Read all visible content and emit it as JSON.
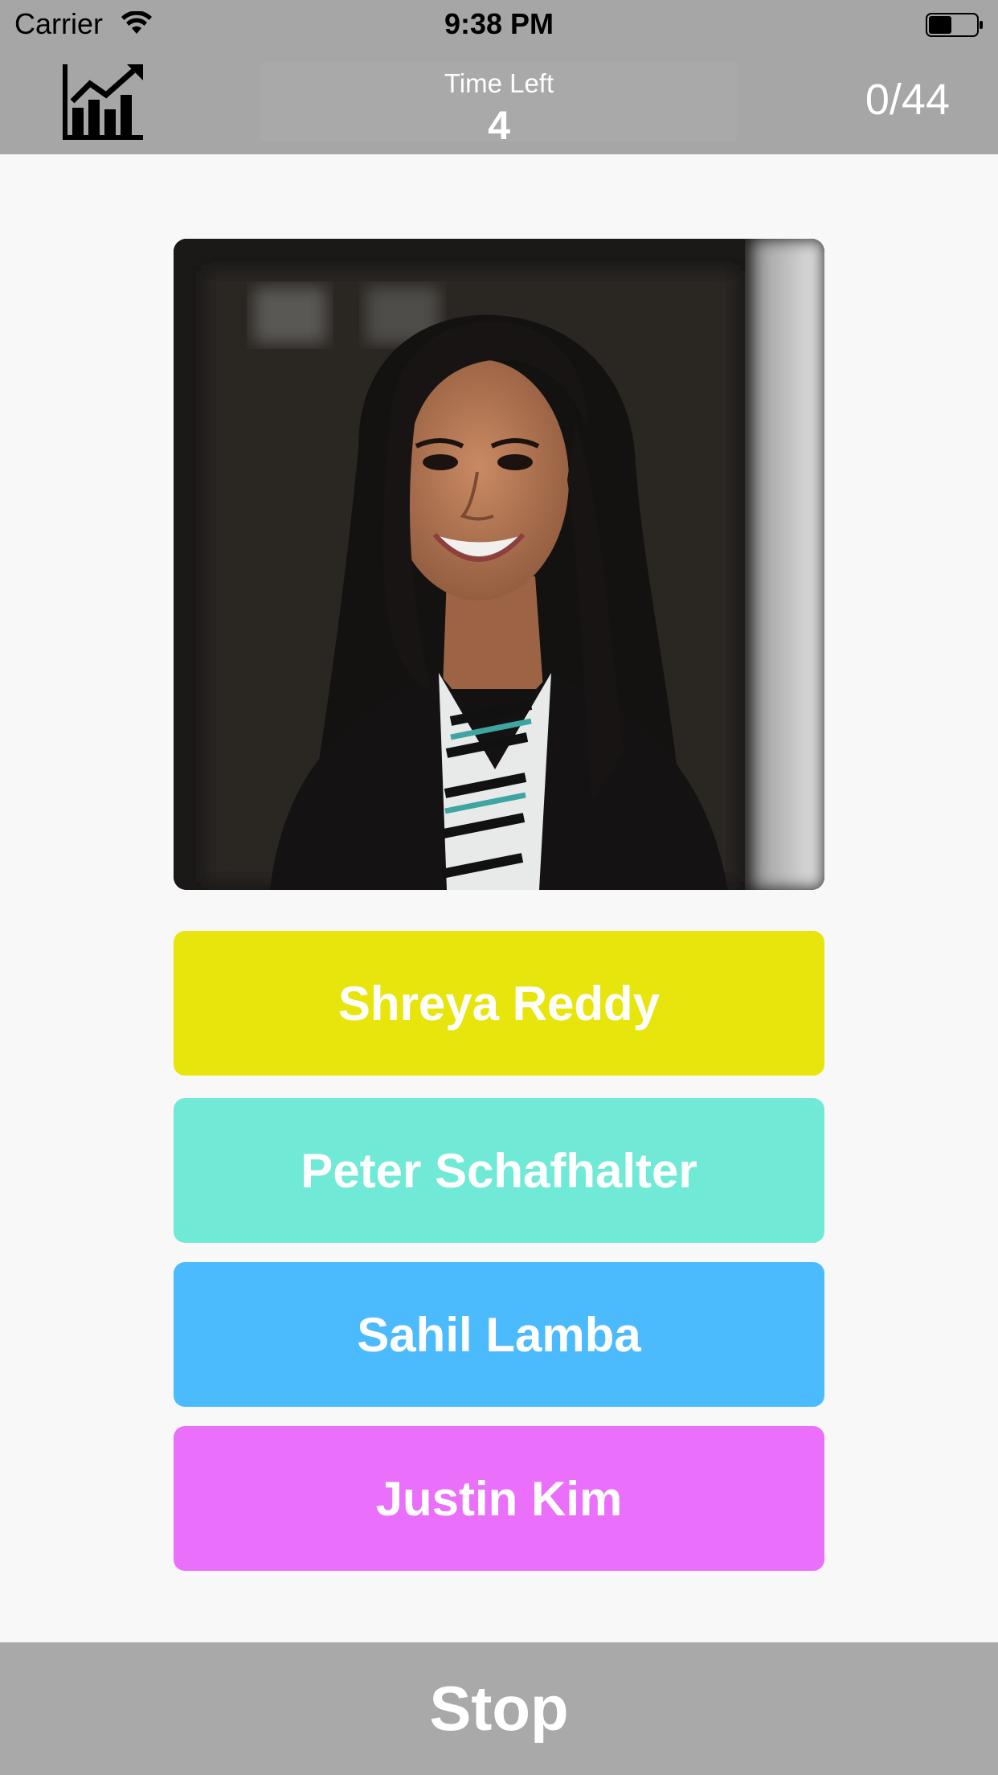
{
  "status_bar": {
    "carrier": "Carrier",
    "time": "9:38 PM",
    "wifi_icon": "wifi-icon",
    "battery_icon": "battery-icon"
  },
  "nav_bar": {
    "stats_icon": "bar-chart-trend-icon",
    "timer_label": "Time Left",
    "timer_value": "4",
    "score": "0/44",
    "background_color": "#a6a6a6"
  },
  "photo": {
    "subject": "portrait-photo"
  },
  "answers": [
    {
      "label": "Shreya Reddy",
      "color": "#e8e50c"
    },
    {
      "label": "Peter Schafhalter",
      "color": "#70ead6"
    },
    {
      "label": "Sahil Lamba",
      "color": "#4cbbfd"
    },
    {
      "label": "Justin Kim",
      "color": "#ea6ffb"
    }
  ],
  "footer": {
    "stop_label": "Stop",
    "background_color": "#a9a9a9"
  }
}
